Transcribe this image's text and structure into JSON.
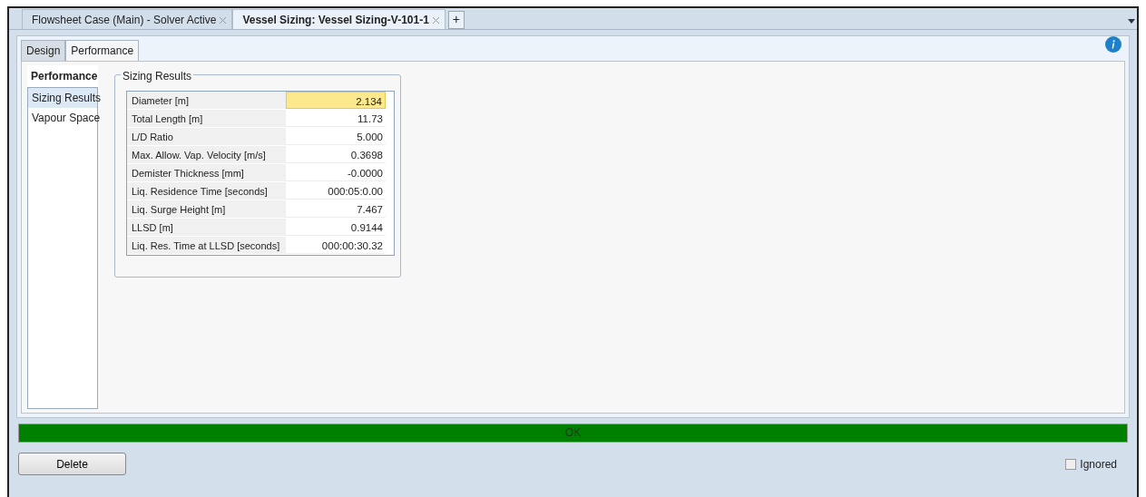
{
  "doc_tabs": [
    {
      "label": "Flowsheet Case (Main) - Solver Active",
      "selected": false
    },
    {
      "label": "Vessel Sizing: Vessel Sizing-V-101-1",
      "selected": true
    }
  ],
  "add_tab": "+",
  "tabs": [
    {
      "label": "Design",
      "selected": false
    },
    {
      "label": "Performance",
      "selected": true
    }
  ],
  "sidebar": {
    "title": "Performance",
    "items": [
      {
        "label": "Sizing Results",
        "selected": true
      },
      {
        "label": "Vapour Space",
        "selected": false
      }
    ]
  },
  "group": {
    "title": "Sizing Results",
    "rows": [
      {
        "label": "Diameter [m]",
        "value": "2.134",
        "highlighted": true
      },
      {
        "label": "Total Length [m]",
        "value": "11.73",
        "highlighted": false
      },
      {
        "label": "L/D Ratio",
        "value": "5.000",
        "highlighted": false
      },
      {
        "label": "Max. Allow. Vap. Velocity [m/s]",
        "value": "0.3698",
        "highlighted": false
      },
      {
        "label": "Demister Thickness [mm]",
        "value": "-0.0000",
        "highlighted": false
      },
      {
        "label": "Liq. Residence Time [seconds]",
        "value": "000:05:0.00",
        "highlighted": false
      },
      {
        "label": "Liq. Surge Height [m]",
        "value": "7.467",
        "highlighted": false
      },
      {
        "label": "LLSD [m]",
        "value": "0.9144",
        "highlighted": false
      },
      {
        "label": "Liq. Res. Time at LLSD [seconds]",
        "value": "000:00:30.32",
        "highlighted": false
      }
    ]
  },
  "status_bar": {
    "text": "OK",
    "color": "#008000"
  },
  "buttons": [
    "Delete"
  ],
  "ignored": {
    "label": "Ignored",
    "checked": false
  }
}
